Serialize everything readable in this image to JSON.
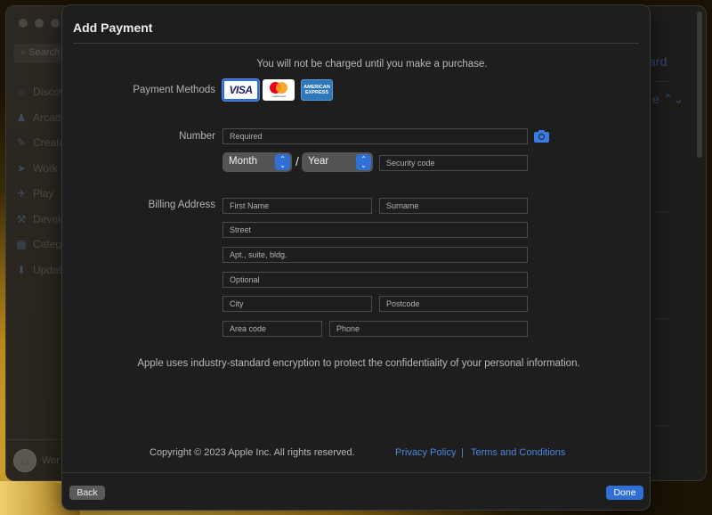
{
  "background_app": {
    "search_placeholder": "Search",
    "sidebar_items": [
      {
        "label": "Discover",
        "icon": "star-icon"
      },
      {
        "label": "Arcade",
        "icon": "joystick-icon"
      },
      {
        "label": "Create",
        "icon": "brush-icon"
      },
      {
        "label": "Work",
        "icon": "paper-plane-icon"
      },
      {
        "label": "Play",
        "icon": "rocket-icon"
      },
      {
        "label": "Develop",
        "icon": "hammer-icon"
      },
      {
        "label": "Categories",
        "icon": "grid-icon"
      },
      {
        "label": "Updates",
        "icon": "download-icon"
      }
    ],
    "user_label": "Wor",
    "right_text_1": "ard",
    "right_text_2": "e ⌃⌄"
  },
  "sheet": {
    "title": "Add Payment",
    "notice": "You will not be charged until you make a purchase.",
    "payment_methods_label": "Payment Methods",
    "cards": [
      {
        "name": "VISA",
        "selected": true
      },
      {
        "name": "Mastercard",
        "sublabel": "mastercard",
        "selected": false
      },
      {
        "name": "American Express",
        "line1": "AMERICAN",
        "line2": "EXPRESS",
        "selected": false
      }
    ],
    "number_label": "Number",
    "number_placeholder": "Required",
    "month_value": "Month",
    "year_value": "Year",
    "expiry_separator": "/",
    "security_code_placeholder": "Security code",
    "billing_label": "Billing Address",
    "billing_fields": {
      "first_name": "First Name",
      "surname": "Surname",
      "street": "Street",
      "apt": "Apt., suite, bldg.",
      "optional": "Optional",
      "city": "City",
      "postcode": "Postcode",
      "area_code": "Area code",
      "phone": "Phone"
    },
    "encryption_notice": "Apple uses industry-standard encryption to protect the confidentiality of your personal information.",
    "copyright": "Copyright © 2023 Apple Inc. All rights reserved.",
    "privacy_link": "Privacy Policy",
    "link_separator": "|",
    "terms_link": "Terms and Conditions",
    "back_button": "Back",
    "done_button": "Done"
  },
  "colors": {
    "accent": "#2f6fd6",
    "link": "#4a86e0",
    "sheet_bg": "#1e1e1e"
  }
}
